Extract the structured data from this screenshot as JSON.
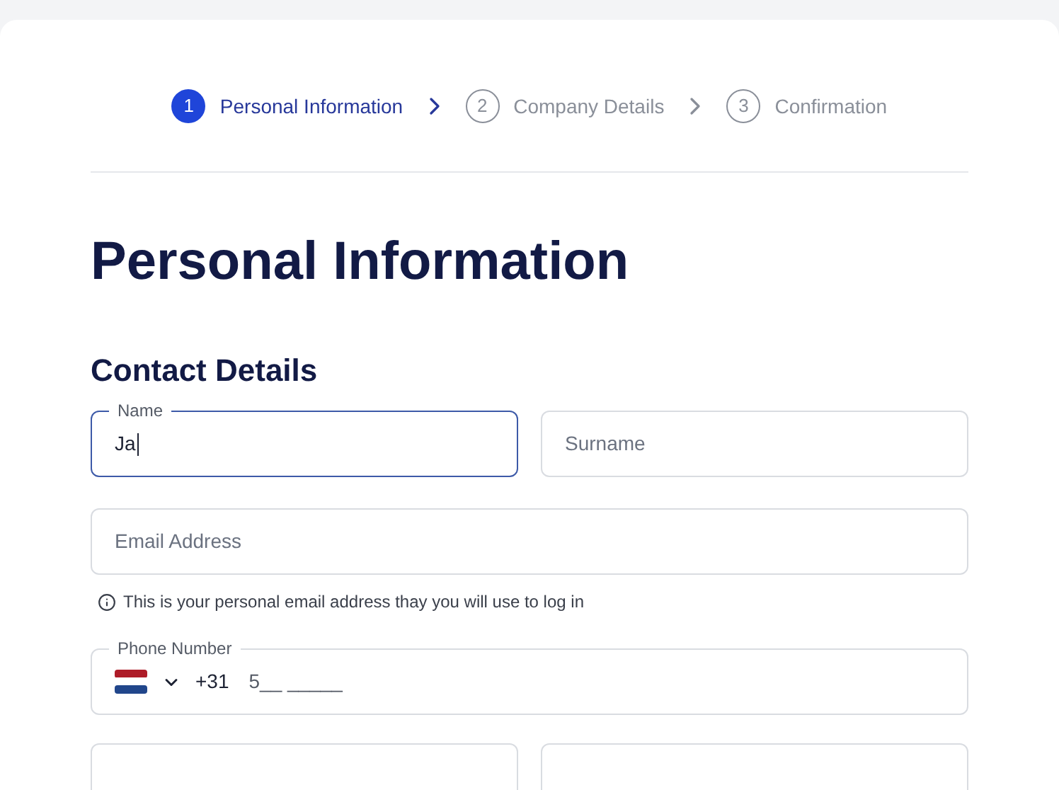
{
  "steps": [
    {
      "number": "1",
      "label": "Personal Information",
      "selected": true
    },
    {
      "number": "2",
      "label": "Company Details",
      "selected": false
    },
    {
      "number": "3",
      "label": "Confirmation",
      "selected": false
    }
  ],
  "heading": "Personal Information",
  "section": "Contact Details",
  "name_field": {
    "label": "Name",
    "value": "Ja",
    "focused": true
  },
  "surname_field": {
    "placeholder": "Surname",
    "focused": false
  },
  "email_field": {
    "placeholder": "Email Address"
  },
  "email_hint": "This is your personal email address thay you will use to log in",
  "phone_field": {
    "label": "Phone Number",
    "code": "+31",
    "value": "5__ _____"
  }
}
